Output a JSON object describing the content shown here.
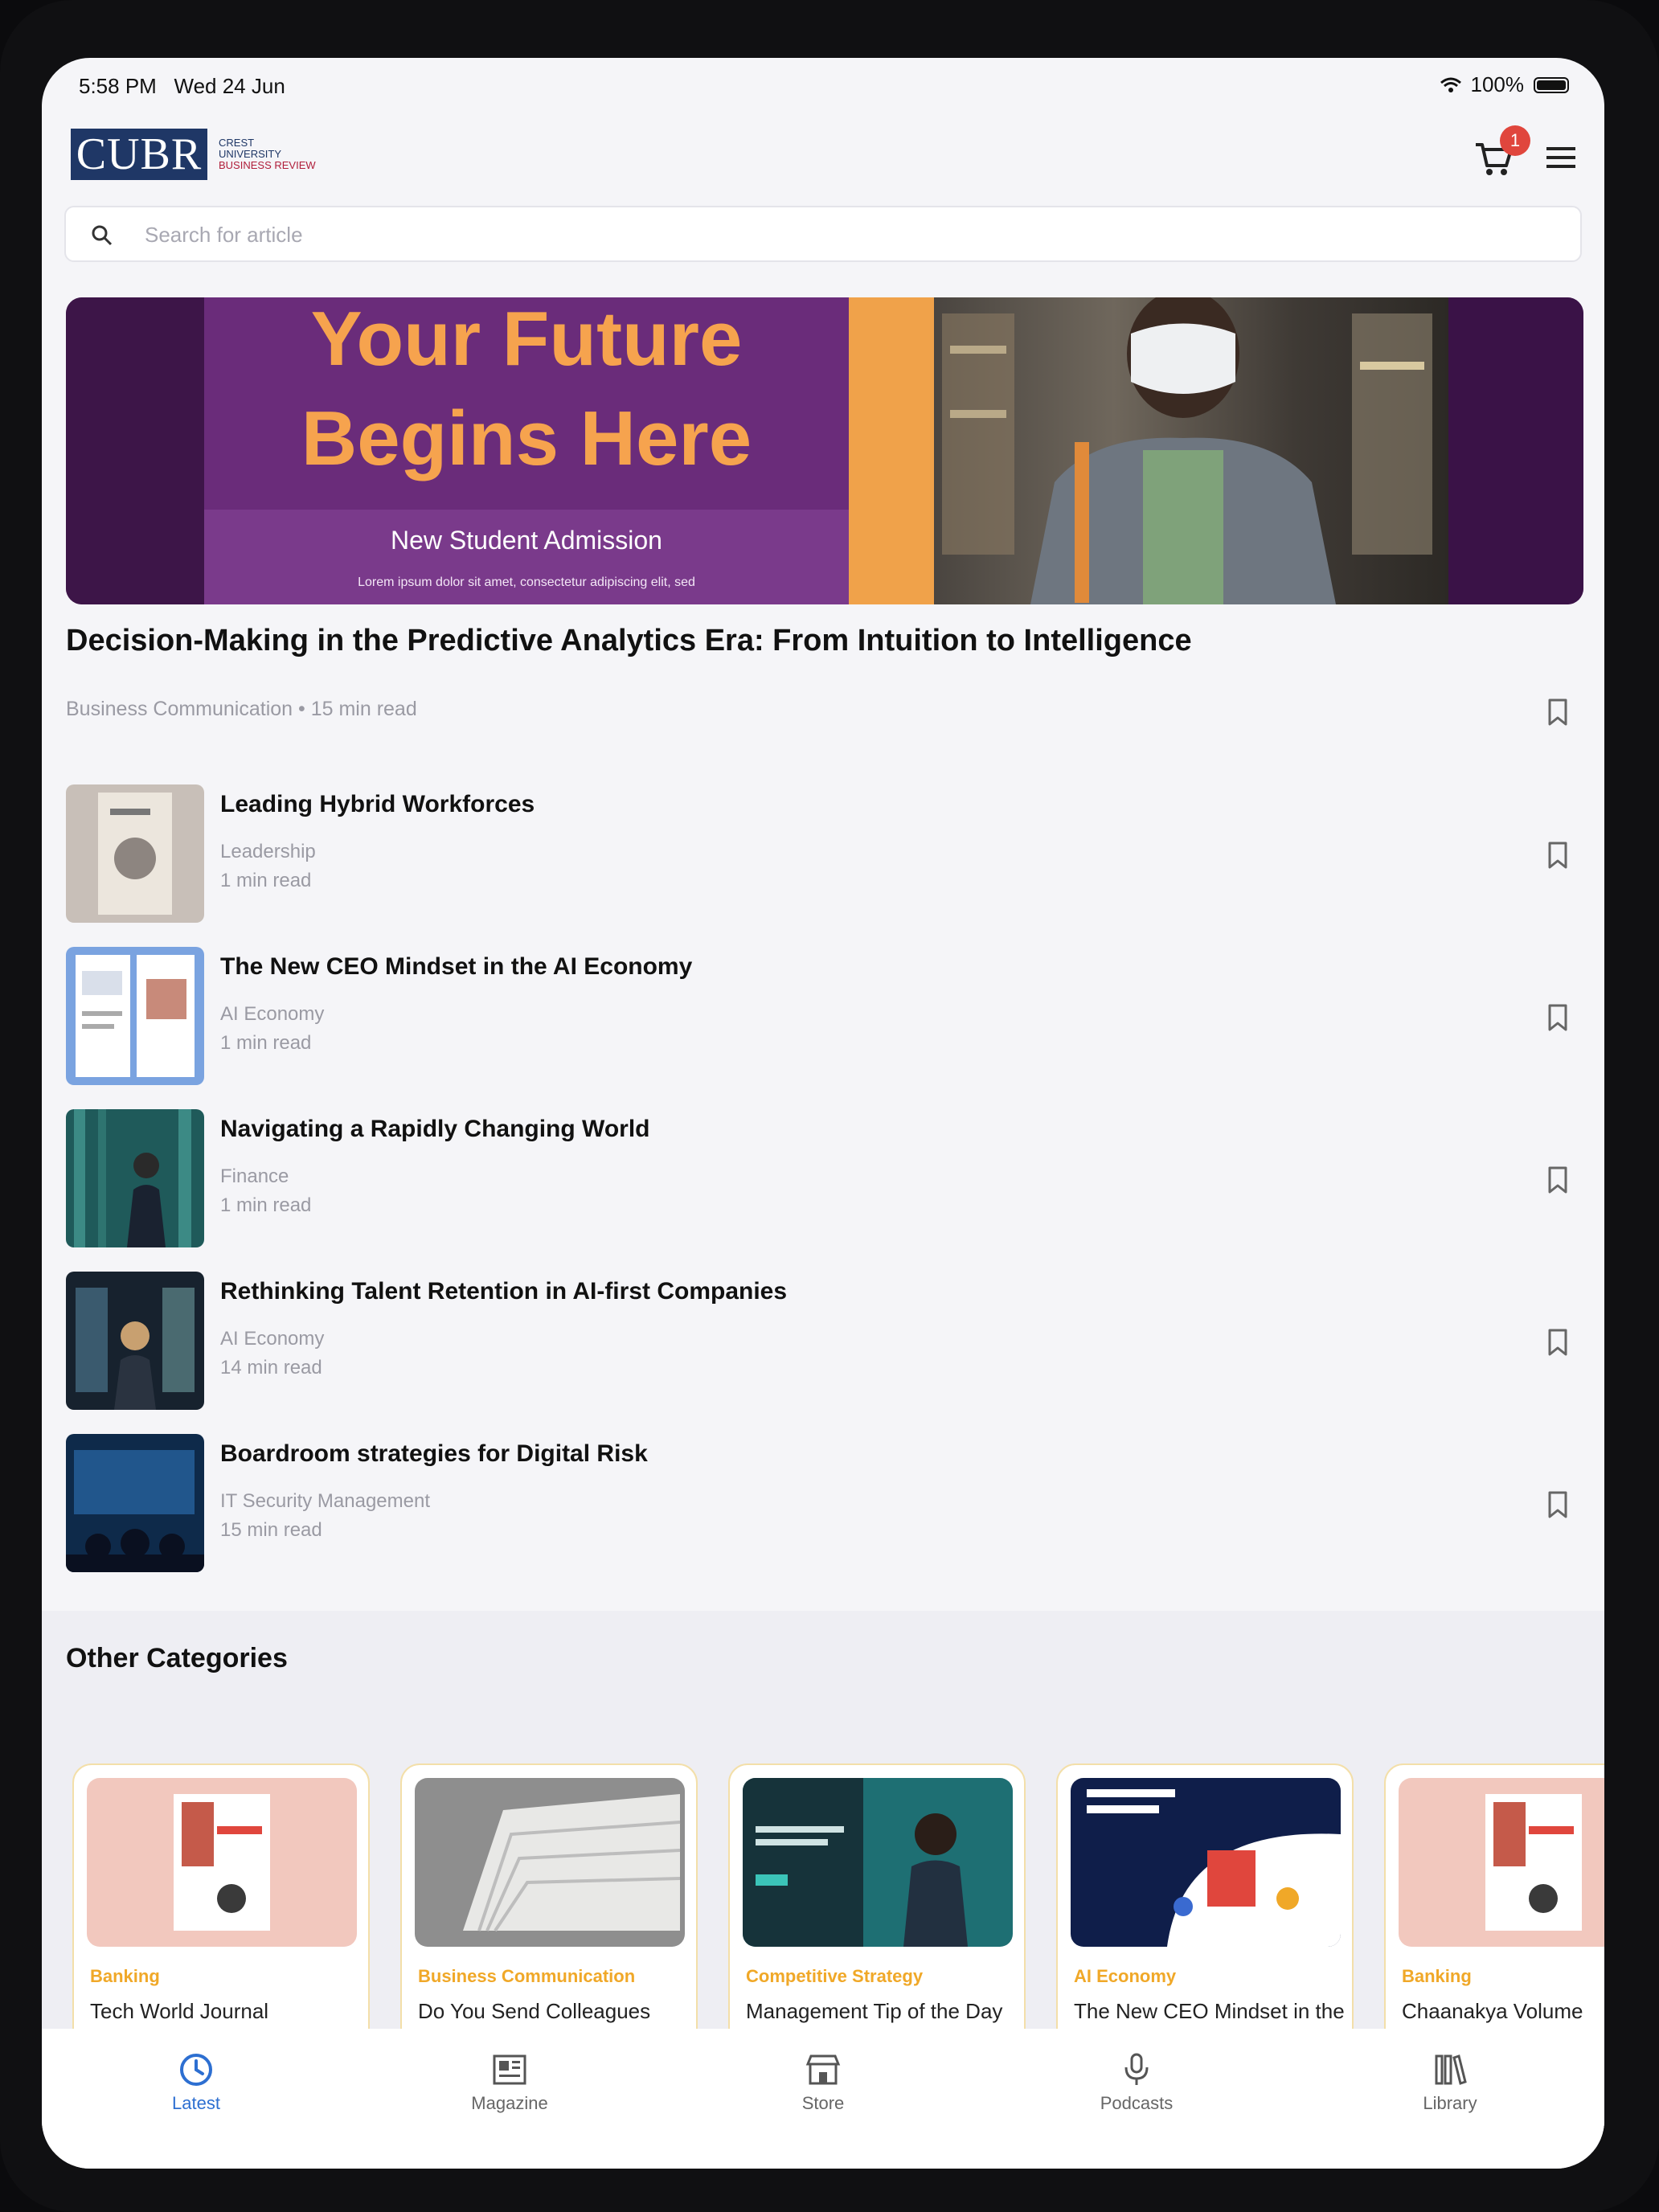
{
  "status_bar": {
    "time": "5:58 PM",
    "date": "Wed 24 Jun",
    "battery": "100%"
  },
  "header": {
    "logo_text": "CUBR",
    "logo_subtitle_1": "CREST",
    "logo_subtitle_2": "UNIVERSITY",
    "logo_subtitle_3": "BUSINESS REVIEW",
    "cart_count": "1"
  },
  "search": {
    "placeholder": "Search for article"
  },
  "banner": {
    "headline_1": "Your Future",
    "headline_2": "Begins Here",
    "subheading": "New Student Admission",
    "body": "Lorem ipsum dolor sit amet, consectetur adipiscing elit, sed"
  },
  "featured": {
    "title": "Decision-Making in the Predictive Analytics Era: From Intuition to Intelligence",
    "meta": "Business Communication • 15 min read"
  },
  "articles": [
    {
      "title": "Leading Hybrid Workforces",
      "category": "Leadership",
      "read_time": "1 min read"
    },
    {
      "title": "The New CEO Mindset in the AI Economy",
      "category": "AI Economy",
      "read_time": "1 min read"
    },
    {
      "title": "Navigating a Rapidly Changing World",
      "category": "Finance",
      "read_time": "1 min read"
    },
    {
      "title": "Rethinking Talent Retention in AI-first Companies",
      "category": "AI Economy",
      "read_time": "14 min read"
    },
    {
      "title": "Boardroom strategies for Digital Risk",
      "category": "IT Security Management",
      "read_time": "15 min read"
    }
  ],
  "other_categories": {
    "heading": "Other Categories",
    "cards": [
      {
        "category": "Banking",
        "title": "Tech World Journal"
      },
      {
        "category": "Business Communication",
        "title": "Do You Send Colleagues Workshop?"
      },
      {
        "category": "Competitive Strategy",
        "title": "Management Tip of the Day"
      },
      {
        "category": "AI Economy",
        "title": "The New CEO Mindset in the AI Economy"
      },
      {
        "category": "Banking",
        "title": "Chaanakya Volume"
      }
    ]
  },
  "tabs": [
    {
      "label": "Latest",
      "icon": "clock-icon"
    },
    {
      "label": "Magazine",
      "icon": "magazine-icon"
    },
    {
      "label": "Store",
      "icon": "store-icon"
    },
    {
      "label": "Podcasts",
      "icon": "microphone-icon"
    },
    {
      "label": "Library",
      "icon": "library-icon"
    }
  ],
  "colors": {
    "accent": "#2d6fd1",
    "category": "#f0a828",
    "brand": "#1f3766",
    "badge": "#e0463d"
  }
}
